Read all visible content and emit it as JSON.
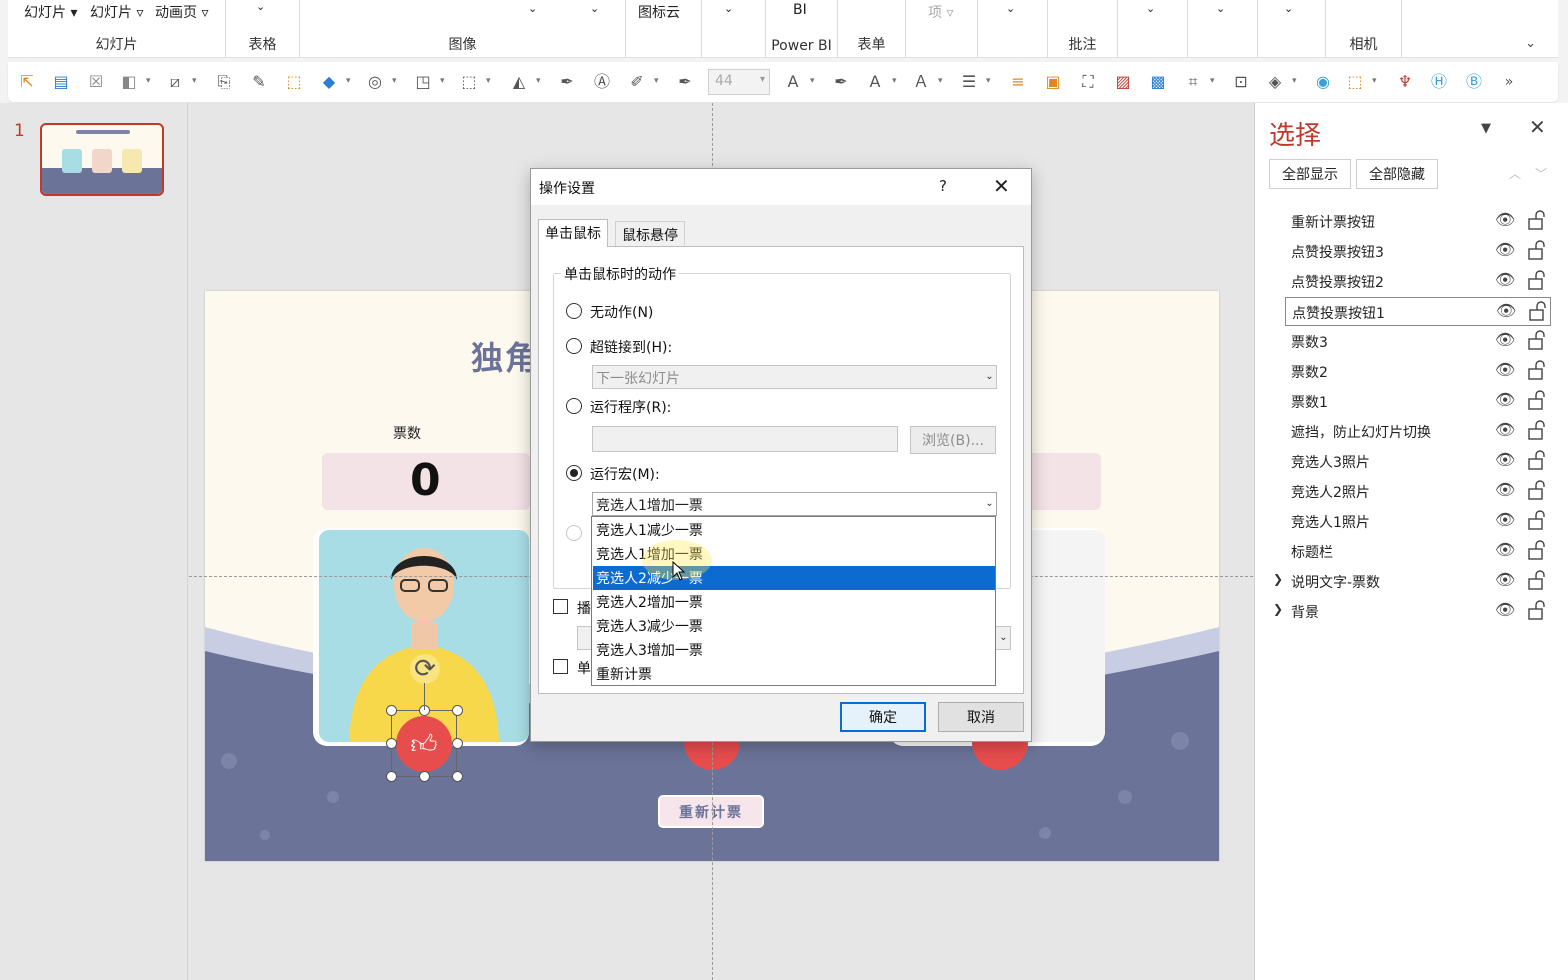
{
  "ribbon": {
    "top_labels": [
      "幻灯片",
      "幻灯片",
      "动画页",
      "BI",
      "图标云",
      "项"
    ],
    "groups": [
      "幻灯片",
      "表格",
      "图像",
      "Power BI",
      "表单",
      "批注",
      "相机"
    ],
    "font_size_value": "44"
  },
  "thumbnails": {
    "slide_number": "1"
  },
  "slide": {
    "title": "独角",
    "votes_label": "票数",
    "vote_value": "0",
    "reset_button": "重新计票"
  },
  "dialog": {
    "title": "操作设置",
    "help": "?",
    "tabs": [
      "单击鼠标",
      "鼠标悬停"
    ],
    "group_label": "单击鼠标时的动作",
    "options": {
      "none": "无动作(N)",
      "hyperlink": "超链接到(H):",
      "program": "运行程序(R):",
      "macro": "运行宏(M):"
    },
    "hyperlink_value": "下一张幻灯片",
    "browse_button": "浏览(B)...",
    "macro_value": "竞选人1增加一票",
    "macro_list": [
      "竞选人1减少一票",
      "竞选人1增加一票",
      "竞选人2减少一票",
      "竞选人2增加一票",
      "竞选人3减少一票",
      "竞选人3增加一票",
      "重新计票"
    ],
    "macro_highlight_index": 2,
    "partial_labels": [
      "播",
      "单"
    ],
    "ok_button": "确定",
    "cancel_button": "取消"
  },
  "selection_pane": {
    "title": "选择",
    "show_all": "全部显示",
    "hide_all": "全部隐藏",
    "items": [
      {
        "name": "重新计票按钮"
      },
      {
        "name": "点赞投票按钮3"
      },
      {
        "name": "点赞投票按钮2"
      },
      {
        "name": "点赞投票按钮1",
        "selected": true
      },
      {
        "name": "票数3"
      },
      {
        "name": "票数2"
      },
      {
        "name": "票数1"
      },
      {
        "name": "遮挡，防止幻灯片切换"
      },
      {
        "name": "竞选人3照片"
      },
      {
        "name": "竞选人2照片"
      },
      {
        "name": "竞选人1照片"
      },
      {
        "name": "标题栏"
      },
      {
        "name": "说明文字-票数",
        "group": true
      },
      {
        "name": "背景",
        "group": true
      }
    ]
  },
  "colors": {
    "accent": "#c0392b",
    "selection_blue": "#0b6bd0",
    "slide_band": "#6b7399"
  }
}
